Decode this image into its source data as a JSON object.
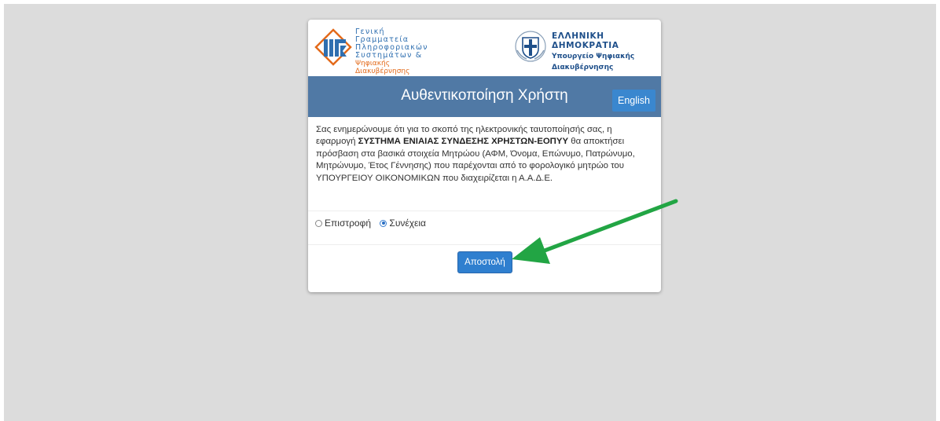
{
  "header": {
    "left_logo_lines": [
      "Γενική Γραμματεία",
      "Πληροφοριακών",
      "Συστημάτων &"
    ],
    "left_logo_sub": "Ψηφιακής Διακυβέρνησης",
    "right_logo_title": "ΕΛΛΗΝΙΚΗ ΔΗΜΟΚΡΑΤΙΑ",
    "right_logo_sub_lines": [
      "Υπουργείο Ψηφιακής",
      "Διακυβέρνησης"
    ]
  },
  "banner": {
    "title": "Αυθεντικοποίηση Χρήστη",
    "language_button": "English"
  },
  "consent": {
    "text_before": "Σας ενημερώνουμε ότι για το σκοπό της ηλεκτρονικής ταυτοποίησής σας, η εφαρμογή ",
    "app_name": "ΣΥΣΤΗΜΑ ΕΝΙΑΙΑΣ ΣΥΝΔΕΣΗΣ ΧΡΗΣΤΩΝ-ΕΟΠΥΥ",
    "text_after": " θα αποκτήσει πρόσβαση στα βασικά στοιχεία Μητρώου (ΑΦΜ, Όνομα, Επώνυμο, Πατρώνυμο, Μητρώνυμο, Έτος Γέννησης) που παρέχονται από το φορολογικό μητρώο του ΥΠΟΥΡΓΕΙΟΥ ΟΙΚΟΝΟΜΙΚΩΝ που διαχειρίζεται η Α.Α.Δ.Ε."
  },
  "options": {
    "back_label": "Επιστροφή",
    "continue_label": "Συνέχεια",
    "selected": "Συνέχεια"
  },
  "submit_label": "Αποστολή",
  "colors": {
    "banner": "#5079a5",
    "button": "#2f7fcf",
    "arrow": "#22a544",
    "background": "#dcdcdc"
  }
}
